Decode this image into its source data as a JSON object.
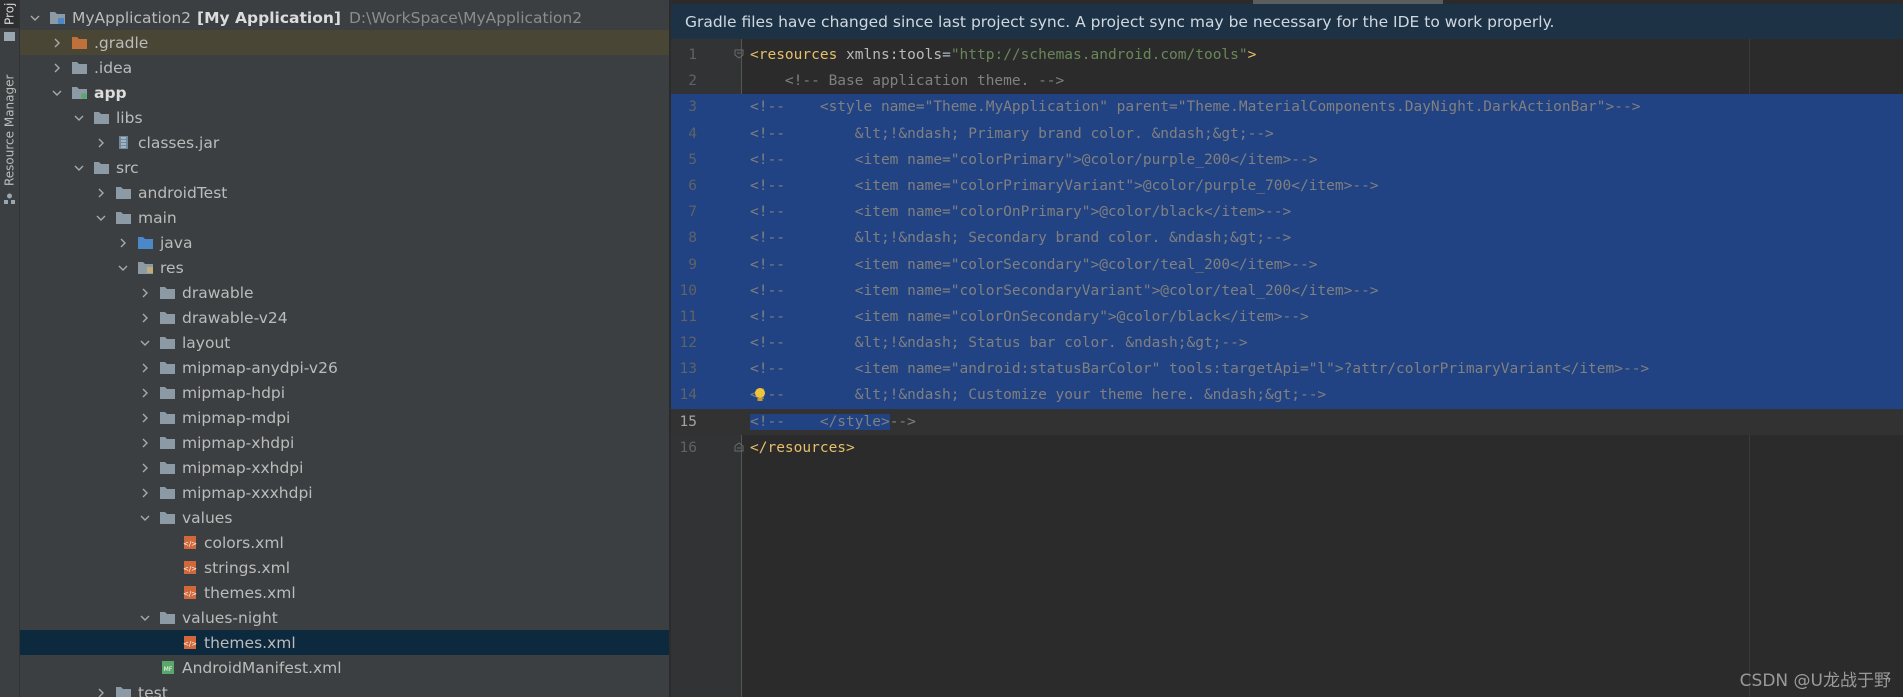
{
  "side_strip": {
    "project_tab": "Proj",
    "resource_manager_tab": "Resource Manager"
  },
  "tree": {
    "root": {
      "name": "MyApplication2",
      "module": "[My Application]",
      "path": "D:\\WorkSpace\\MyApplication2"
    },
    "items": [
      {
        "label": ".gradle"
      },
      {
        "label": ".idea"
      },
      {
        "label": "app"
      },
      {
        "label": "libs"
      },
      {
        "label": "classes.jar"
      },
      {
        "label": "src"
      },
      {
        "label": "androidTest"
      },
      {
        "label": "main"
      },
      {
        "label": "java"
      },
      {
        "label": "res"
      },
      {
        "label": "drawable"
      },
      {
        "label": "drawable-v24"
      },
      {
        "label": "layout"
      },
      {
        "label": "mipmap-anydpi-v26"
      },
      {
        "label": "mipmap-hdpi"
      },
      {
        "label": "mipmap-mdpi"
      },
      {
        "label": "mipmap-xhdpi"
      },
      {
        "label": "mipmap-xxhdpi"
      },
      {
        "label": "mipmap-xxxhdpi"
      },
      {
        "label": "values"
      },
      {
        "label": "colors.xml"
      },
      {
        "label": "strings.xml"
      },
      {
        "label": "themes.xml"
      },
      {
        "label": "values-night"
      },
      {
        "label": "themes.xml"
      },
      {
        "label": "AndroidManifest.xml"
      },
      {
        "label": "test"
      }
    ]
  },
  "editor": {
    "banner": "Gradle files have changed since last project sync. A project sync may be necessary for the IDE to work properly.",
    "lines": [
      {
        "num": "1",
        "text": "<resources xmlns:tools=\"http://schemas.android.com/tools\">"
      },
      {
        "num": "2",
        "text": "    <!-- Base application theme. -->"
      },
      {
        "num": "3",
        "text": "<!--    <style name=\"Theme.MyApplication\" parent=\"Theme.MaterialComponents.DayNight.DarkActionBar\">-->"
      },
      {
        "num": "4",
        "text": "<!--        &lt;!&ndash; Primary brand color. &ndash;&gt;-->"
      },
      {
        "num": "5",
        "text": "<!--        <item name=\"colorPrimary\">@color/purple_200</item>-->"
      },
      {
        "num": "6",
        "text": "<!--        <item name=\"colorPrimaryVariant\">@color/purple_700</item>-->"
      },
      {
        "num": "7",
        "text": "<!--        <item name=\"colorOnPrimary\">@color/black</item>-->"
      },
      {
        "num": "8",
        "text": "<!--        &lt;!&ndash; Secondary brand color. &ndash;&gt;-->"
      },
      {
        "num": "9",
        "text": "<!--        <item name=\"colorSecondary\">@color/teal_200</item>-->"
      },
      {
        "num": "10",
        "text": "<!--        <item name=\"colorSecondaryVariant\">@color/teal_200</item>-->"
      },
      {
        "num": "11",
        "text": "<!--        <item name=\"colorOnSecondary\">@color/black</item>-->"
      },
      {
        "num": "12",
        "text": "<!--        &lt;!&ndash; Status bar color. &ndash;&gt;-->"
      },
      {
        "num": "13",
        "text": "<!--        <item name=\"android:statusBarColor\" tools:targetApi=\"l\">?attr/colorPrimaryVariant</item>-->"
      },
      {
        "num": "14",
        "text": "<!--        &lt;!&ndash; Customize your theme here. &ndash;&gt;-->"
      },
      {
        "num": "15",
        "text": "<!--    </style>-->"
      },
      {
        "num": "16",
        "text": "</resources>"
      }
    ]
  },
  "watermark": "CSDN @U龙战于野",
  "colors": {
    "selection": "#214283",
    "tree_selected": "#0d293e",
    "banner": "#1e3246",
    "tag": "#e8bf6a",
    "string": "#6a8759",
    "comment": "#808080"
  }
}
